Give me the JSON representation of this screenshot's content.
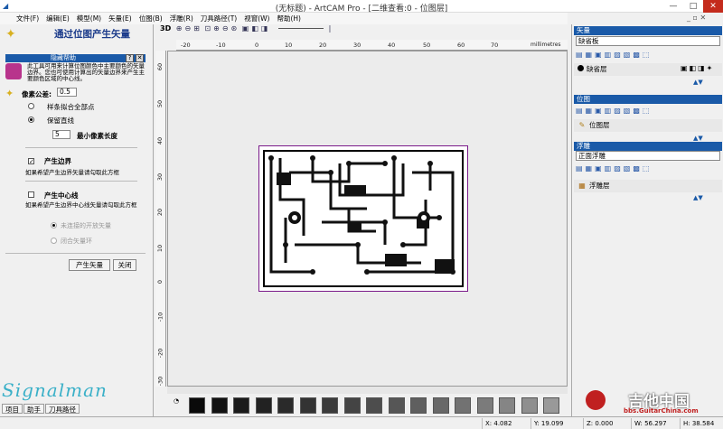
{
  "app": {
    "title": "(无标题) - ArtCAM Pro - [二维查看:0 - 位图层]",
    "icon": "artcam-logo-icon"
  },
  "menu": [
    "文件(F)",
    "编辑(E)",
    "模型(M)",
    "矢量(E)",
    "位图(B)",
    "浮雕(R)",
    "刀具路径(T)",
    "视窗(W)",
    "帮助(H)"
  ],
  "left": {
    "title": "通过位图产生矢量",
    "hidden_help": "隐藏帮助",
    "help_text": "此工具可用来计算位图颜色中主要颜色的矢量边界。您也可使用计算出的矢量边界来产生主要颜色区域的中心线。",
    "pixel_tolerance_label": "像素公差:",
    "pixel_tolerance_value": "0.5",
    "spline_fit": "样条拟合全部点",
    "keep_lines": "保留直线",
    "min_pixel_value": "5",
    "min_pixel_label": "最小像素长度",
    "create_boundary": "产生边界",
    "boundary_desc": "如果希望产生边界矢量请勾取此方框",
    "create_centerline": "产生中心线",
    "centerline_desc": "如果希望产生边界中心线矢量请勾取此方框",
    "unconnected": "未连接的开放矢量",
    "closed_loop": "闭合矢量环",
    "create_vector_button": "产生矢量",
    "close_button": "关闭"
  },
  "toolbar": {
    "mode": "3D",
    "units": "millimetres"
  },
  "ruler_h": [
    "-20",
    "-10",
    "0",
    "10",
    "20",
    "30",
    "40",
    "50",
    "60",
    "70"
  ],
  "ruler_v": [
    "60",
    "50",
    "40",
    "30",
    "20",
    "10",
    "0",
    "-10",
    "-20",
    "-30"
  ],
  "swatches": [
    "#0a0a0a",
    "#121212",
    "#1a1a1a",
    "#222222",
    "#2a2a2a",
    "#333333",
    "#3b3b3b",
    "#444444",
    "#4d4d4d",
    "#565656",
    "#5f5f5f",
    "#686868",
    "#727272",
    "#7b7b7b",
    "#858585",
    "#8f8f8f",
    "#999999"
  ],
  "right": {
    "vector_header": "矢量",
    "vector_select": "缺省板",
    "vector_layer": "缺省层",
    "bitmap_header": "位图",
    "bitmap_layer": "位图层",
    "relief_header": "浮雕",
    "relief_select": "正面浮雕",
    "relief_layer": "浮雕层"
  },
  "tabs": [
    "项目",
    "助手",
    "刀具路径"
  ],
  "status": {
    "x": "X: 4.082",
    "y": "Y: 19.099",
    "z": "Z: 0.000",
    "w": "W: 56.297",
    "h": "H: 38.584"
  },
  "watermark": "Signalman",
  "logo": {
    "cn": "吉他中国",
    "url": "bbs.GuitarChina.com"
  },
  "colors": {
    "accent": "#1a5aa8",
    "pcb_border": "#7a1a8a"
  }
}
